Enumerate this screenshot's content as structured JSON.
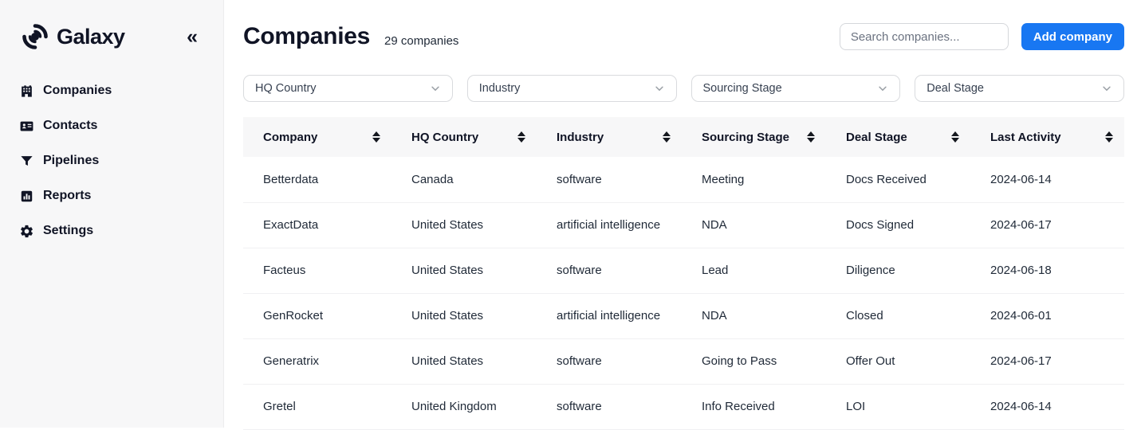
{
  "sidebar": {
    "app_name": "Galaxy",
    "collapse_glyph": "«",
    "items": [
      {
        "label": "Companies",
        "icon": "building-icon"
      },
      {
        "label": "Contacts",
        "icon": "contact-card-icon"
      },
      {
        "label": "Pipelines",
        "icon": "funnel-icon"
      },
      {
        "label": "Reports",
        "icon": "bar-chart-icon"
      },
      {
        "label": "Settings",
        "icon": "gear-icon"
      }
    ]
  },
  "header": {
    "title": "Companies",
    "count_label": "29 companies",
    "search_placeholder": "Search companies...",
    "add_button_label": "Add company"
  },
  "filters": [
    {
      "label": "HQ Country"
    },
    {
      "label": "Industry"
    },
    {
      "label": "Sourcing Stage"
    },
    {
      "label": "Deal Stage"
    }
  ],
  "table": {
    "columns": [
      "Company",
      "HQ Country",
      "Industry",
      "Sourcing Stage",
      "Deal Stage",
      "Last Activity"
    ],
    "rows": [
      [
        "Betterdata",
        "Canada",
        "software",
        "Meeting",
        "Docs Received",
        "2024-06-14"
      ],
      [
        "ExactData",
        "United States",
        "artificial intelligence",
        "NDA",
        "Docs Signed",
        "2024-06-17"
      ],
      [
        "Facteus",
        "United States",
        "software",
        "Lead",
        "Diligence",
        "2024-06-18"
      ],
      [
        "GenRocket",
        "United States",
        "artificial intelligence",
        "NDA",
        "Closed",
        "2024-06-01"
      ],
      [
        "Generatrix",
        "United States",
        "software",
        "Going to Pass",
        "Offer Out",
        "2024-06-17"
      ],
      [
        "Gretel",
        "United Kingdom",
        "software",
        "Info Received",
        "LOI",
        "2024-06-14"
      ]
    ]
  },
  "colors": {
    "accent_blue": "#1877f2",
    "sidebar_bg": "#f7f7f8",
    "text_dark": "#101425",
    "header_row_bg": "#f7f7f8",
    "border_light": "#d9dbde",
    "row_divider": "#f0f0f2"
  }
}
